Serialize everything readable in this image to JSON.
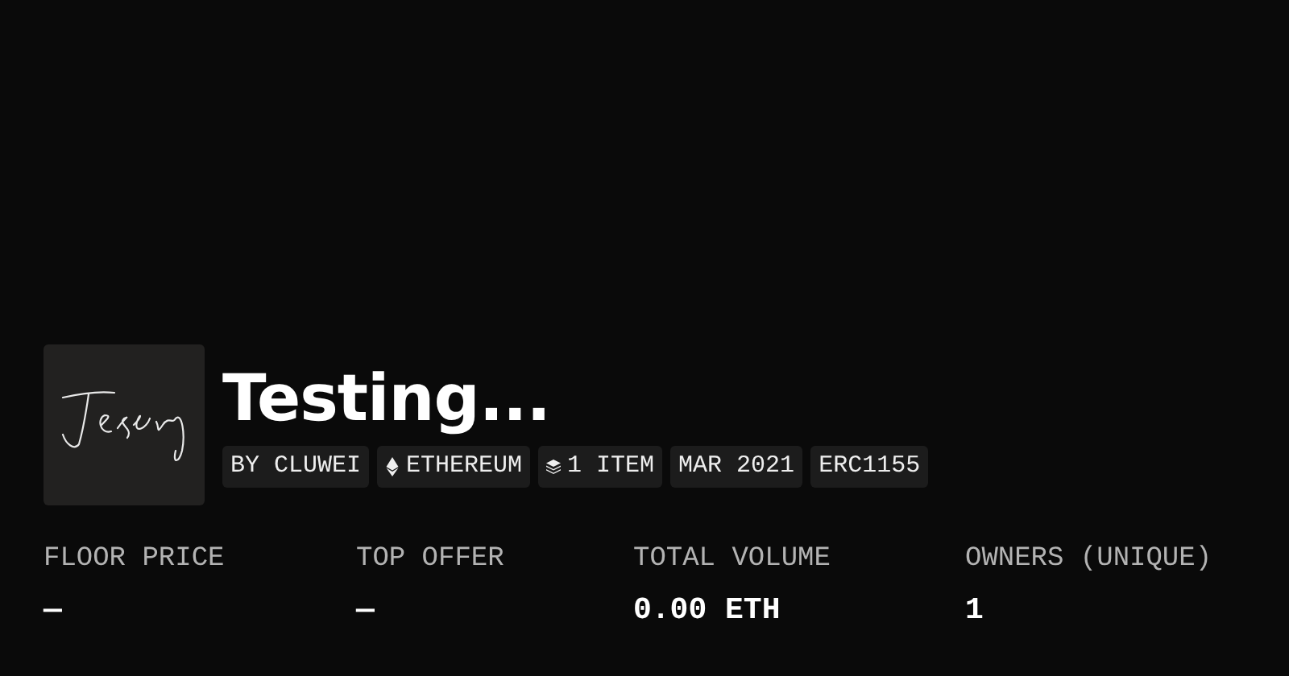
{
  "collection": {
    "title": "Testing...",
    "tags": [
      {
        "kind": "text",
        "label": "BY CLUWEI"
      },
      {
        "kind": "chain",
        "label": "ETHEREUM"
      },
      {
        "kind": "items",
        "label": "1 ITEM"
      },
      {
        "kind": "text",
        "label": "MAR 2021"
      },
      {
        "kind": "text",
        "label": "ERC1155"
      }
    ]
  },
  "stats": [
    {
      "label": "FLOOR PRICE",
      "value": "—"
    },
    {
      "label": "TOP OFFER",
      "value": "—"
    },
    {
      "label": "TOTAL VOLUME",
      "value": "0.00 ETH"
    },
    {
      "label": "OWNERS (UNIQUE)",
      "value": "1"
    }
  ]
}
